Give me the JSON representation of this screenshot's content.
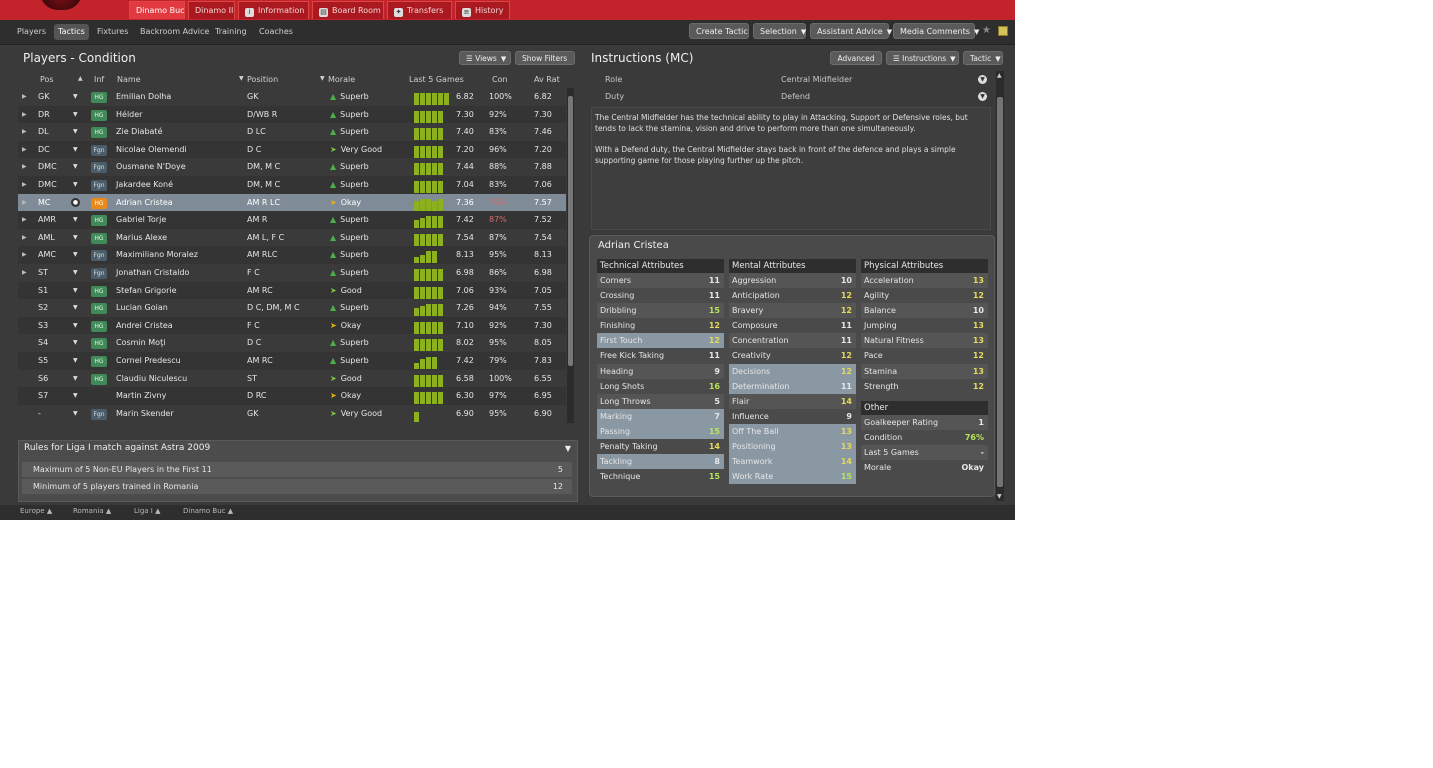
{
  "top_tabs": [
    {
      "label": "Dinamo Buc",
      "active": true
    },
    {
      "label": "Dinamo II",
      "active": false
    },
    {
      "label": "Information",
      "active": false
    },
    {
      "label": "Board Room",
      "active": false
    },
    {
      "label": "Transfers",
      "active": false
    },
    {
      "label": "History",
      "active": false
    }
  ],
  "subnav": {
    "items": [
      "Players",
      "Tactics",
      "Fixtures",
      "Backroom Advice",
      "Training",
      "Coaches"
    ],
    "active": "Tactics",
    "buttons": [
      "Create Tactic",
      "Selection",
      "Assistant Advice",
      "Media Comments"
    ]
  },
  "left_panel": {
    "title": "Players - Condition",
    "views_btn": "Views",
    "filters_btn": "Show Filters",
    "columns": [
      "Pos",
      "Inf",
      "Name",
      "Position",
      "Morale",
      "Last 5 Games",
      "Con",
      "Av Rat"
    ],
    "players": [
      {
        "pos": "GK",
        "inf": "HG",
        "name": "Emilian Dolha",
        "position": "GK",
        "morale": "Superb",
        "last5": [
          6,
          6,
          6,
          6,
          6,
          6
        ],
        "rat": "6.82",
        "con": "100%",
        "av": "6.82"
      },
      {
        "pos": "DR",
        "inf": "HG",
        "name": "Hélder",
        "position": "D/WB R",
        "morale": "Superb",
        "last5": [
          6,
          6,
          6,
          6,
          6
        ],
        "rat": "7.30",
        "con": "92%",
        "av": "7.30"
      },
      {
        "pos": "DL",
        "inf": "HG",
        "name": "Zie Diabaté",
        "position": "D LC",
        "morale": "Superb",
        "last5": [
          6,
          6,
          6,
          6,
          6
        ],
        "rat": "7.40",
        "con": "83%",
        "av": "7.46"
      },
      {
        "pos": "DC",
        "inf": "Fgn",
        "name": "Nicolae Olemendi",
        "position": "D C",
        "morale": "Very Good",
        "last5": [
          6,
          6,
          6,
          6,
          6
        ],
        "rat": "7.20",
        "con": "96%",
        "av": "7.20"
      },
      {
        "pos": "DMC",
        "inf": "Fgn",
        "name": "Ousmane N'Doye",
        "position": "DM, M C",
        "morale": "Superb",
        "last5": [
          6,
          6,
          6,
          6,
          6
        ],
        "rat": "7.44",
        "con": "88%",
        "av": "7.88"
      },
      {
        "pos": "DMC",
        "inf": "Fgn",
        "name": "Jakardee Koné",
        "position": "DM, M C",
        "morale": "Superb",
        "last5": [
          6,
          6,
          6,
          6,
          6
        ],
        "rat": "7.04",
        "con": "83%",
        "av": "7.06"
      },
      {
        "pos": "MC",
        "inf": "HG",
        "name": "Adrian Cristea",
        "position": "AM R LC",
        "morale": "Okay",
        "last5": [
          5,
          6,
          6,
          5,
          6
        ],
        "rat": "7.36",
        "con": "76%",
        "av": "7.57"
      },
      {
        "pos": "AMR",
        "inf": "HG",
        "name": "Gabriel Torje",
        "position": "AM R",
        "morale": "Superb",
        "last5": [
          4,
          5,
          6,
          6,
          6
        ],
        "rat": "7.42",
        "con": "87%",
        "av": "7.52"
      },
      {
        "pos": "AML",
        "inf": "HG",
        "name": "Marius Alexe",
        "position": "AM L, F C",
        "morale": "Superb",
        "last5": [
          6,
          6,
          6,
          6,
          6
        ],
        "rat": "7.54",
        "con": "87%",
        "av": "7.54"
      },
      {
        "pos": "AMC",
        "inf": "Fgn",
        "name": "Maximiliano Moralez",
        "position": "AM RLC",
        "morale": "Superb",
        "last5": [
          3,
          4,
          6,
          6
        ],
        "rat": "8.13",
        "con": "95%",
        "av": "8.13"
      },
      {
        "pos": "ST",
        "inf": "Fgn",
        "name": "Jonathan Cristaldo",
        "position": "F C",
        "morale": "Superb",
        "last5": [
          6,
          6,
          6,
          6,
          6
        ],
        "rat": "6.98",
        "con": "86%",
        "av": "6.98"
      },
      {
        "pos": "S1",
        "inf": "HG",
        "name": "Stefan Grigorie",
        "position": "AM RC",
        "morale": "Good",
        "last5": [
          6,
          6,
          6,
          6,
          6
        ],
        "rat": "7.06",
        "con": "93%",
        "av": "7.05"
      },
      {
        "pos": "S2",
        "inf": "HG",
        "name": "Lucian Goian",
        "position": "D C, DM, M C",
        "morale": "Superb",
        "last5": [
          4,
          5,
          6,
          6,
          6
        ],
        "rat": "7.26",
        "con": "94%",
        "av": "7.55"
      },
      {
        "pos": "S3",
        "inf": "HG",
        "name": "Andrei Cristea",
        "position": "F C",
        "morale": "Okay",
        "last5": [
          6,
          6,
          6,
          6,
          6
        ],
        "rat": "7.10",
        "con": "92%",
        "av": "7.30"
      },
      {
        "pos": "S4",
        "inf": "HG",
        "name": "Cosmin Moţi",
        "position": "D C",
        "morale": "Superb",
        "last5": [
          6,
          6,
          6,
          6,
          6
        ],
        "rat": "8.02",
        "con": "95%",
        "av": "8.05"
      },
      {
        "pos": "S5",
        "inf": "HG",
        "name": "Cornel Predescu",
        "position": "AM RC",
        "morale": "Superb",
        "last5": [
          3,
          5,
          6,
          6
        ],
        "rat": "7.42",
        "con": "79%",
        "av": "7.83"
      },
      {
        "pos": "S6",
        "inf": "HG",
        "name": "Claudiu Niculescu",
        "position": "ST",
        "morale": "Good",
        "last5": [
          6,
          6,
          6,
          6,
          6
        ],
        "rat": "6.58",
        "con": "100%",
        "av": "6.55"
      },
      {
        "pos": "S7",
        "inf": "",
        "name": "Martin Zivny",
        "position": "D RC",
        "morale": "Okay",
        "last5": [
          6,
          6,
          6,
          6,
          6
        ],
        "rat": "6.30",
        "con": "97%",
        "av": "6.95"
      },
      {
        "pos": "-",
        "inf": "Fgn",
        "name": "Marin Skender",
        "position": "GK",
        "morale": "Very Good",
        "last5": [
          5
        ],
        "rat": "6.90",
        "con": "95%",
        "av": "6.90"
      }
    ]
  },
  "rules": {
    "title": "Rules for Liga I match against Astra 2009",
    "items": [
      {
        "text": "Maximum of 5 Non-EU Players in the First 11",
        "value": "5"
      },
      {
        "text": "Minimum of 5 players trained in Romania",
        "value": "12"
      }
    ]
  },
  "crumbs": [
    "Europe",
    "Romania",
    "Liga I",
    "Dinamo Buc"
  ],
  "instructions": {
    "title": "Instructions (MC)",
    "buttons": [
      "Advanced",
      "Instructions",
      "Tactic"
    ],
    "role_label": "Role",
    "role_value": "Central Midfielder",
    "duty_label": "Duty",
    "duty_value": "Defend",
    "desc1": "The Central Midfielder has the technical ability to play in Attacking, Support or Defensive roles, but tends to lack the stamina, vision and drive to perform more than one simultaneously.",
    "desc2": "With a Defend duty, the Central Midfielder stays back in front of the defence and plays a simple supporting game for those playing further up the pitch."
  },
  "profile": {
    "name": "Adrian Cristea",
    "technical_title": "Technical Attributes",
    "technical": [
      {
        "n": "Corners",
        "v": "11"
      },
      {
        "n": "Crossing",
        "v": "11"
      },
      {
        "n": "Dribbling",
        "v": "15"
      },
      {
        "n": "Finishing",
        "v": "12"
      },
      {
        "n": "First Touch",
        "v": "12",
        "hl": true
      },
      {
        "n": "Free Kick Taking",
        "v": "11"
      },
      {
        "n": "Heading",
        "v": "9"
      },
      {
        "n": "Long Shots",
        "v": "16"
      },
      {
        "n": "Long Throws",
        "v": "5"
      },
      {
        "n": "Marking",
        "v": "7",
        "hl": true
      },
      {
        "n": "Passing",
        "v": "15",
        "hl": true
      },
      {
        "n": "Penalty Taking",
        "v": "14"
      },
      {
        "n": "Tackling",
        "v": "8",
        "hl": true
      },
      {
        "n": "Technique",
        "v": "15"
      }
    ],
    "mental_title": "Mental Attributes",
    "mental": [
      {
        "n": "Aggression",
        "v": "10"
      },
      {
        "n": "Anticipation",
        "v": "12"
      },
      {
        "n": "Bravery",
        "v": "12"
      },
      {
        "n": "Composure",
        "v": "11"
      },
      {
        "n": "Concentration",
        "v": "11"
      },
      {
        "n": "Creativity",
        "v": "12"
      },
      {
        "n": "Decisions",
        "v": "12",
        "hl": true
      },
      {
        "n": "Determination",
        "v": "11",
        "hl": true
      },
      {
        "n": "Flair",
        "v": "14"
      },
      {
        "n": "Influence",
        "v": "9"
      },
      {
        "n": "Off The Ball",
        "v": "13",
        "hl": true
      },
      {
        "n": "Positioning",
        "v": "13",
        "hl": true
      },
      {
        "n": "Teamwork",
        "v": "14",
        "hl": true
      },
      {
        "n": "Work Rate",
        "v": "15",
        "hl": true
      }
    ],
    "physical_title": "Physical Attributes",
    "physical": [
      {
        "n": "Acceleration",
        "v": "13"
      },
      {
        "n": "Agility",
        "v": "12"
      },
      {
        "n": "Balance",
        "v": "10"
      },
      {
        "n": "Jumping",
        "v": "13"
      },
      {
        "n": "Natural Fitness",
        "v": "13"
      },
      {
        "n": "Pace",
        "v": "12"
      },
      {
        "n": "Stamina",
        "v": "13"
      },
      {
        "n": "Strength",
        "v": "12"
      }
    ],
    "other_title": "Other",
    "other": [
      {
        "n": "Goalkeeper Rating",
        "v": "1"
      },
      {
        "n": "Condition",
        "v": "76%"
      },
      {
        "n": "Last 5 Games",
        "v": "-"
      },
      {
        "n": "Morale",
        "v": "Okay"
      }
    ]
  },
  "colors": {
    "accent_red": "#c3242b",
    "hg_green": "#3f8a57",
    "form_bar": "#8cb01e",
    "selected_row": "#7f8c97"
  }
}
